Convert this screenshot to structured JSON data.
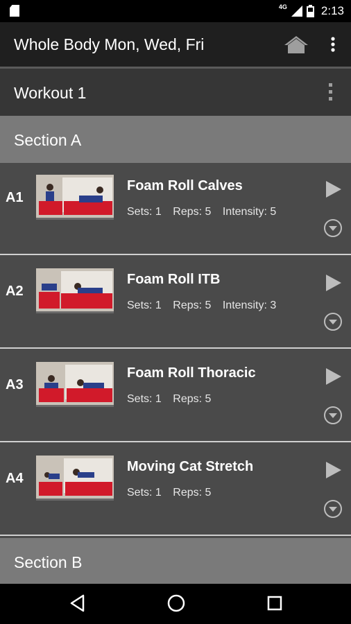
{
  "status_bar": {
    "network": "4G",
    "time": "2:13",
    "icons": [
      "sd-card-icon",
      "signal-icon",
      "battery-icon"
    ]
  },
  "app_bar": {
    "title": "Whole Body Mon, Wed, Fri",
    "icons": [
      "home-icon",
      "more-vert-icon"
    ]
  },
  "workout": {
    "label": "Workout 1"
  },
  "sections": [
    {
      "label": "Section A",
      "exercises": [
        {
          "code": "A1",
          "name": "Foam Roll Calves",
          "sets": "Sets: 1",
          "reps": "Reps: 5",
          "intensity": "Intensity: 5"
        },
        {
          "code": "A2",
          "name": "Foam Roll ITB",
          "sets": "Sets: 1",
          "reps": "Reps: 5",
          "intensity": "Intensity: 3"
        },
        {
          "code": "A3",
          "name": "Foam Roll Thoracic",
          "sets": "Sets: 1",
          "reps": "Reps: 5"
        },
        {
          "code": "A4",
          "name": "Moving Cat Stretch",
          "sets": "Sets: 1",
          "reps": "Reps: 5"
        }
      ]
    },
    {
      "label": "Section B",
      "exercises": []
    }
  ],
  "nav_bar": {
    "icons": [
      "back-icon",
      "home-circle-icon",
      "recents-icon"
    ]
  },
  "colors": {
    "appbar": "#1f1f1f",
    "section_header": "#7a7a7a",
    "row_background": "#4a4a4a",
    "mat_red": "#d11a2a"
  }
}
